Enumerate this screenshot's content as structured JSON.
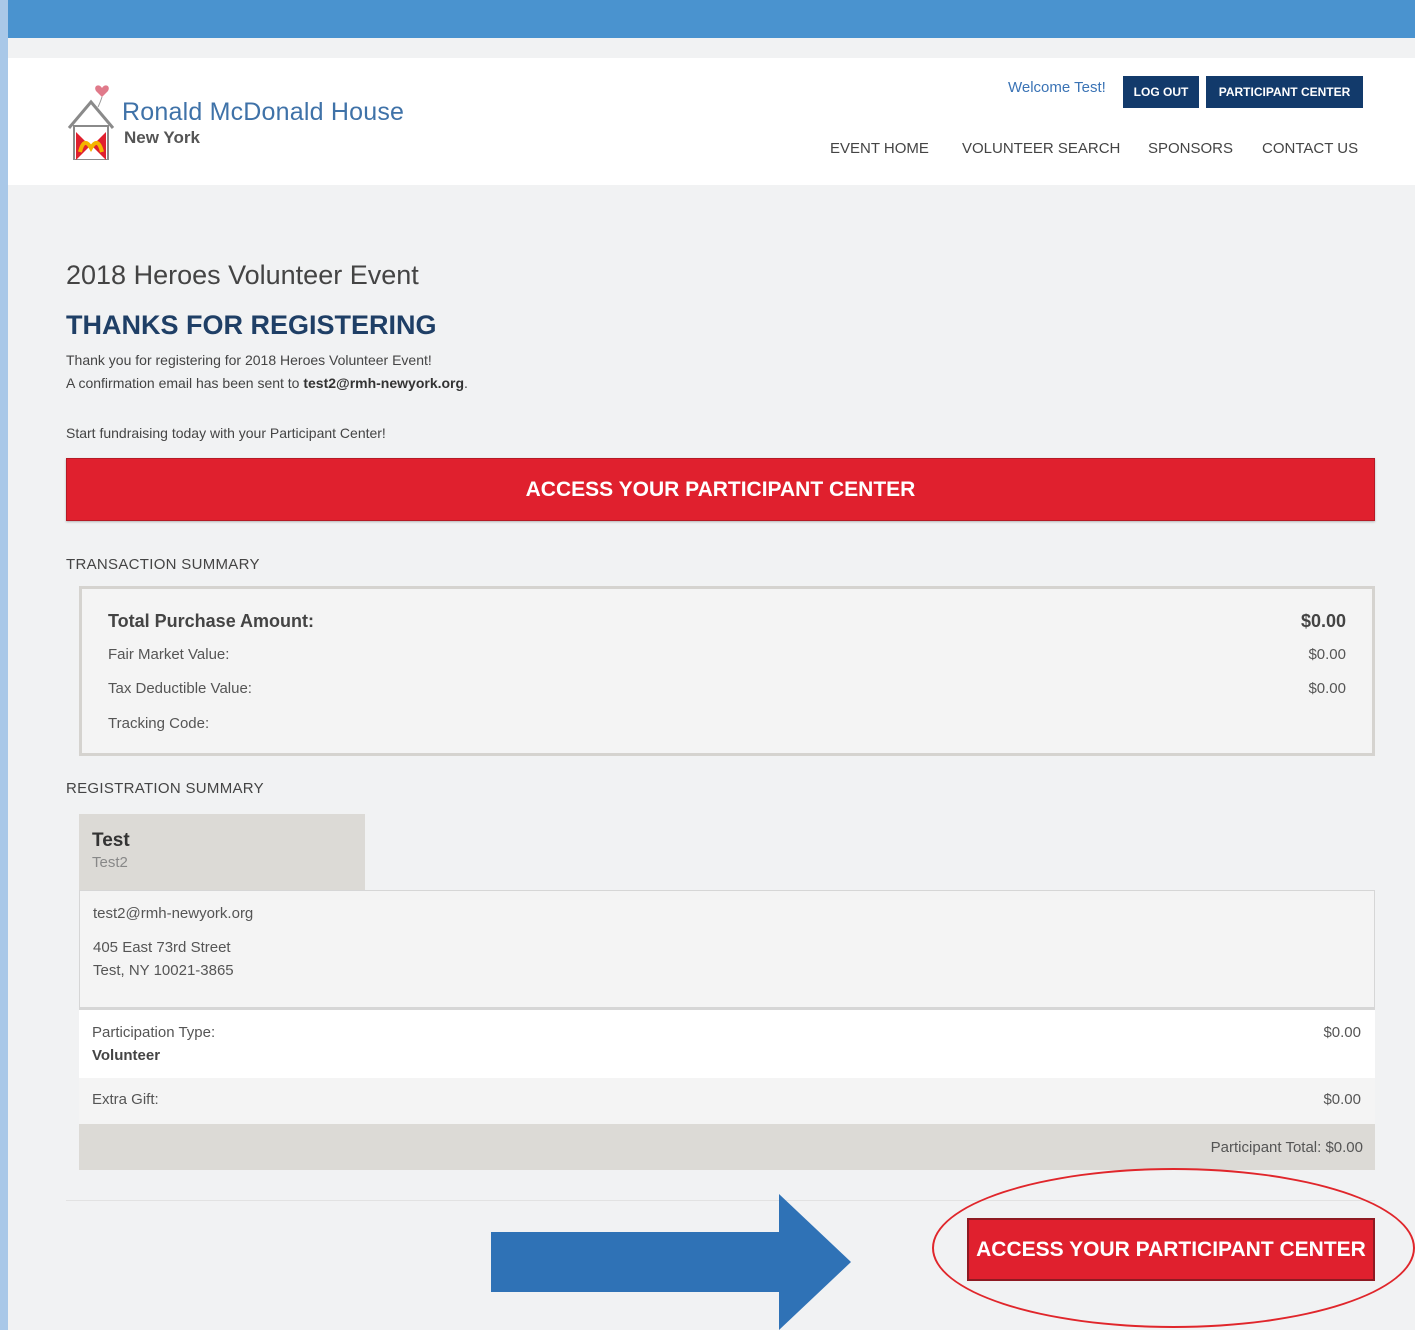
{
  "brand": {
    "name": "Ronald McDonald House",
    "city": "New York"
  },
  "header": {
    "welcome": "Welcome Test!",
    "logout_label": "LOG OUT",
    "participant_center_label": "PARTICIPANT CENTER",
    "nav": [
      "EVENT HOME",
      "VOLUNTEER SEARCH",
      "SPONSORS",
      "CONTACT US"
    ]
  },
  "main": {
    "event_title": "2018 Heroes Volunteer Event",
    "heading": "THANKS FOR REGISTERING",
    "thank_you_text": "Thank you for registering for 2018 Heroes Volunteer Event!",
    "confirmation_prefix": "A confirmation email has been sent to ",
    "confirmation_email": "test2@rmh-newyork.org",
    "confirmation_suffix": ".",
    "fundraising_text": "Start fundraising today with your Participant Center!",
    "access_button_label": "ACCESS YOUR PARTICIPANT CENTER"
  },
  "transaction": {
    "section_label": "TRANSACTION SUMMARY",
    "total_label": "Total Purchase Amount:",
    "total_value": "$0.00",
    "fair_market_label": "Fair Market Value:",
    "fair_market_value": "$0.00",
    "tax_deductible_label": "Tax Deductible Value:",
    "tax_deductible_value": "$0.00",
    "tracking_label": "Tracking Code:"
  },
  "registration": {
    "section_label": "REGISTRATION SUMMARY",
    "name": "Test",
    "sub_name": "Test2",
    "email": "test2@rmh-newyork.org",
    "address_line1": "405 East 73rd Street",
    "address_line2": "Test, NY 10021-3865",
    "participation_type_label": "Participation Type:",
    "participation_type_value": "Volunteer",
    "participation_amount": "$0.00",
    "extra_gift_label": "Extra Gift:",
    "extra_gift_amount": "$0.00",
    "participant_total": "Participant Total: $0.00"
  },
  "footer": {
    "access_button_label": "ACCESS YOUR PARTICIPANT CENTER"
  },
  "colors": {
    "brand_blue": "#4a93cf",
    "dark_navy": "#123a6b",
    "cta_red": "#e0202e",
    "arrow_blue": "#2f72b6"
  }
}
